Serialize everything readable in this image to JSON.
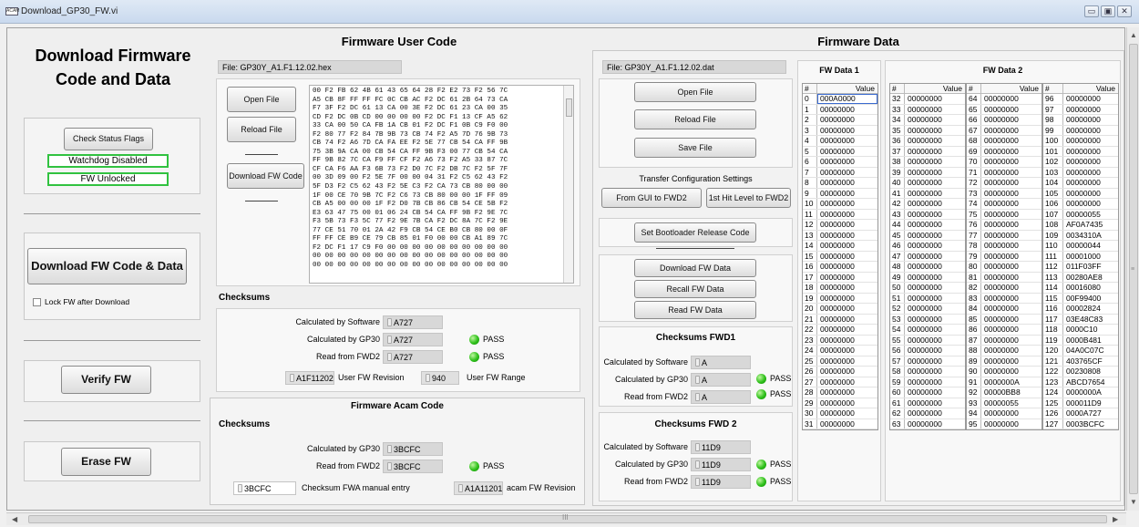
{
  "window": {
    "title": "Download_GP30_FW.vi",
    "icon_text": "ACAM",
    "min": "▭",
    "max": "▣",
    "close": "✕"
  },
  "left": {
    "title_line1": "Download Firmware",
    "title_line2": "Code and Data",
    "check_status": "Check Status Flags",
    "watchdog": "Watchdog Disabled",
    "fw_lock": "FW Unlocked",
    "download_all": "Download FW Code & Data",
    "lock_after": "Lock FW after Download",
    "verify": "Verify FW",
    "erase": "Erase FW"
  },
  "user_code": {
    "header": "Firmware User Code",
    "file": "File:  GP30Y_A1.F1.12.02.hex",
    "open": "Open File",
    "reload": "Reload File",
    "download": "Download FW Code",
    "hex": "00 F2 FB 62 4B 61 43 65 64 28 F2 E2 73 F2 56 7C\nA5 CB 8F FF FF FC 0C CB AC F2 DC 61 2B 64 73 CA\nF7 3F F2 DC 61 13 CA 00 3E F2 DC 61 23 CA 00 35\nCD F2 DC 0B CD 00 00 00 00 F2 DC F1 13 CF A5 62\n33 CA 00 50 CA FB 1A CB 01 F2 DC F1 0B C9 F0 00\nF2 80 77 F2 84 7B 9B 73 CB 74 F2 A5 7D 76 9B 73\nCB 74 F2 A6 7D CA FA EE F2 5E 77 CB 54 CA FF 9B\n75 3B 9A CA 00 CB 54 CA FF 9B F3 00 77 CB 54 CA\nFF 9B 82 7C CA F9 FF CF F2 A6 73 F2 A5 33 87 7C\nCF CA F6 AA F3 6B 73 F2 D0 7C F2 DB 7C F2 5F 7F\n00 3D 09 00 F2 5E 7F 00 00 04 31 F2 C5 62 43 F2\n5F D3 F2 C5 62 43 F2 5E C3 F2 CA 73 CB 80 00 00\n1F 00 CE 70 9B 7C F2 C6 73 CB 80 00 00 1F FF 09\nCB A5 00 00 00 1F F2 D0 7B CB 86 CB 54 CE 5B F2\nE3 63 47 75 00 01 06 24 CB 54 CA FF 9B F2 9E 7C\nF3 5B 73 F3 5C 77 F2 9E 7B CA F2 DC 8A 7C F2 9E\n77 CE 51 70 01 2A 42 F9 CB 54 CE B0 CB 80 00 0F\nFF FF CE B9 CE 79 CB 85 01 F0 00 00 CB A1 89 7C\nF2 DC F1 17 C9 F0 00 00 00 00 00 00 00 00 00 00\n00 00 00 00 00 00 00 00 00 00 00 00 00 00 00 00\n00 00 00 00 00 00 00 00 00 00 00 00 00 00 00 00",
    "checksums": "Checksums",
    "calc_sw": "Calculated by Software",
    "calc_sw_val": "A727",
    "calc_gp30": "Calculated by GP30",
    "calc_gp30_val": "A727",
    "read_fwd2": "Read from FWD2",
    "read_fwd2_val": "A727",
    "pass1": "PASS",
    "pass2": "PASS",
    "rev_val": "A1F11202",
    "rev_label": "User FW Revision",
    "range_val": "940",
    "range_label": "User FW Range"
  },
  "acam": {
    "header": "Firmware Acam Code",
    "checksums": "Checksums",
    "calc_gp30": "Calculated by GP30",
    "calc_gp30_val": "3BCFC",
    "read_fwd2": "Read from FWD2",
    "read_fwd2_val": "3BCFC",
    "pass": "PASS",
    "manual_val": "3BCFC",
    "manual_label": "Checksum FWA manual entry",
    "rev_val": "A1A11201",
    "rev_label": "acam FW Revision"
  },
  "fw_data": {
    "header": "Firmware Data",
    "file": "File:  GP30Y_A1.F1.12.02.dat",
    "open": "Open File",
    "reload": "Reload File",
    "save": "Save File",
    "transfer": "Transfer Configuration Settings",
    "from_gui": "From GUI to FWD2",
    "first_hit": "1st Hit Level to FWD2",
    "bootloader": "Set Bootloader Release Code",
    "download": "Download FW Data",
    "recall": "Recall FW Data",
    "read": "Read FW Data",
    "cs1_title": "Checksums FWD1",
    "cs1_sw": "Calculated by Software",
    "cs1_sw_val": "A",
    "cs1_gp30": "Calculated by GP30",
    "cs1_gp30_val": "A",
    "cs1_read": "Read from FWD2",
    "cs1_read_val": "A",
    "cs1_pass1": "PASS",
    "cs1_pass2": "PASS",
    "cs2_title": "Checksums FWD 2",
    "cs2_sw": "Calculated by Software",
    "cs2_sw_val": "11D9",
    "cs2_gp30": "Calculated by GP30",
    "cs2_gp30_val": "11D9",
    "cs2_read": "Read from FWD2",
    "cs2_read_val": "11D9",
    "cs2_pass1": "PASS",
    "cs2_pass2": "PASS"
  },
  "fw_data1": {
    "title": "FW Data 1",
    "col_idx": "#",
    "col_val": "Value",
    "rows": [
      [
        "0",
        "000A0000"
      ],
      [
        "1",
        "00000000"
      ],
      [
        "2",
        "00000000"
      ],
      [
        "3",
        "00000000"
      ],
      [
        "4",
        "00000000"
      ],
      [
        "5",
        "00000000"
      ],
      [
        "6",
        "00000000"
      ],
      [
        "7",
        "00000000"
      ],
      [
        "8",
        "00000000"
      ],
      [
        "9",
        "00000000"
      ],
      [
        "10",
        "00000000"
      ],
      [
        "11",
        "00000000"
      ],
      [
        "12",
        "00000000"
      ],
      [
        "13",
        "00000000"
      ],
      [
        "14",
        "00000000"
      ],
      [
        "15",
        "00000000"
      ],
      [
        "16",
        "00000000"
      ],
      [
        "17",
        "00000000"
      ],
      [
        "18",
        "00000000"
      ],
      [
        "19",
        "00000000"
      ],
      [
        "20",
        "00000000"
      ],
      [
        "21",
        "00000000"
      ],
      [
        "22",
        "00000000"
      ],
      [
        "23",
        "00000000"
      ],
      [
        "24",
        "00000000"
      ],
      [
        "25",
        "00000000"
      ],
      [
        "26",
        "00000000"
      ],
      [
        "27",
        "00000000"
      ],
      [
        "28",
        "00000000"
      ],
      [
        "29",
        "00000000"
      ],
      [
        "30",
        "00000000"
      ],
      [
        "31",
        "00000000"
      ]
    ]
  },
  "fw_data2": {
    "title": "FW Data 2",
    "col_idx": "#",
    "col_val": "Value",
    "col_a": [
      [
        "32",
        "00000000"
      ],
      [
        "33",
        "00000000"
      ],
      [
        "34",
        "00000000"
      ],
      [
        "35",
        "00000000"
      ],
      [
        "36",
        "00000000"
      ],
      [
        "37",
        "00000000"
      ],
      [
        "38",
        "00000000"
      ],
      [
        "39",
        "00000000"
      ],
      [
        "40",
        "00000000"
      ],
      [
        "41",
        "00000000"
      ],
      [
        "42",
        "00000000"
      ],
      [
        "43",
        "00000000"
      ],
      [
        "44",
        "00000000"
      ],
      [
        "45",
        "00000000"
      ],
      [
        "46",
        "00000000"
      ],
      [
        "47",
        "00000000"
      ],
      [
        "48",
        "00000000"
      ],
      [
        "49",
        "00000000"
      ],
      [
        "50",
        "00000000"
      ],
      [
        "51",
        "00000000"
      ],
      [
        "52",
        "00000000"
      ],
      [
        "53",
        "00000000"
      ],
      [
        "54",
        "00000000"
      ],
      [
        "55",
        "00000000"
      ],
      [
        "56",
        "00000000"
      ],
      [
        "57",
        "00000000"
      ],
      [
        "58",
        "00000000"
      ],
      [
        "59",
        "00000000"
      ],
      [
        "60",
        "00000000"
      ],
      [
        "61",
        "00000000"
      ],
      [
        "62",
        "00000000"
      ],
      [
        "63",
        "00000000"
      ]
    ],
    "col_b": [
      [
        "64",
        "00000000"
      ],
      [
        "65",
        "00000000"
      ],
      [
        "66",
        "00000000"
      ],
      [
        "67",
        "00000000"
      ],
      [
        "68",
        "00000000"
      ],
      [
        "69",
        "00000000"
      ],
      [
        "70",
        "00000000"
      ],
      [
        "71",
        "00000000"
      ],
      [
        "72",
        "00000000"
      ],
      [
        "73",
        "00000000"
      ],
      [
        "74",
        "00000000"
      ],
      [
        "75",
        "00000000"
      ],
      [
        "76",
        "00000000"
      ],
      [
        "77",
        "00000000"
      ],
      [
        "78",
        "00000000"
      ],
      [
        "79",
        "00000000"
      ],
      [
        "80",
        "00000000"
      ],
      [
        "81",
        "00000000"
      ],
      [
        "82",
        "00000000"
      ],
      [
        "83",
        "00000000"
      ],
      [
        "84",
        "00000000"
      ],
      [
        "85",
        "00000000"
      ],
      [
        "86",
        "00000000"
      ],
      [
        "87",
        "00000000"
      ],
      [
        "88",
        "00000000"
      ],
      [
        "89",
        "00000000"
      ],
      [
        "90",
        "00000000"
      ],
      [
        "91",
        "0000000A"
      ],
      [
        "92",
        "00000BB8"
      ],
      [
        "93",
        "00000055"
      ],
      [
        "94",
        "00000000"
      ],
      [
        "95",
        "00000000"
      ]
    ],
    "col_c": [
      [
        "96",
        "00000000"
      ],
      [
        "97",
        "00000000"
      ],
      [
        "98",
        "00000000"
      ],
      [
        "99",
        "00000000"
      ],
      [
        "100",
        "00000000"
      ],
      [
        "101",
        "00000000"
      ],
      [
        "102",
        "00000000"
      ],
      [
        "103",
        "00000000"
      ],
      [
        "104",
        "00000000"
      ],
      [
        "105",
        "00000000"
      ],
      [
        "106",
        "00000000"
      ],
      [
        "107",
        "00000055"
      ],
      [
        "108",
        "AF0A7435"
      ],
      [
        "109",
        "0034310A"
      ],
      [
        "110",
        "00000044"
      ],
      [
        "111",
        "00001000"
      ],
      [
        "112",
        "011F03FF"
      ],
      [
        "113",
        "00280AE8"
      ],
      [
        "114",
        "00016080"
      ],
      [
        "115",
        "00F99400"
      ],
      [
        "116",
        "00002824"
      ],
      [
        "117",
        "03E48C83"
      ],
      [
        "118",
        "0000C10"
      ],
      [
        "119",
        "0000B481"
      ],
      [
        "120",
        "04A0C07C"
      ],
      [
        "121",
        "403765CF"
      ],
      [
        "122",
        "00230808"
      ],
      [
        "123",
        "ABCD7654"
      ],
      [
        "124",
        "0000000A"
      ],
      [
        "125",
        "000011D9"
      ],
      [
        "126",
        "0000A727"
      ],
      [
        "127",
        "0003BCFC"
      ]
    ]
  },
  "scroll": {
    "grip": "≡",
    "hgrip": "III",
    "left": "◀",
    "right": "▶"
  }
}
